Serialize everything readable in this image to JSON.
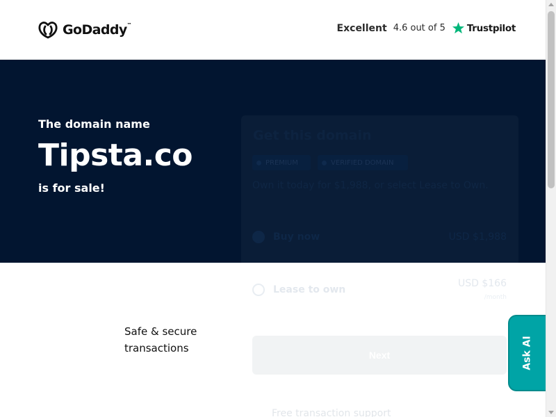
{
  "header": {
    "logo_text": "GoDaddy",
    "logo_tm": "™",
    "rating_label": "Excellent",
    "rating_score": "4.6 out of 5",
    "trustpilot": "Trustpilot"
  },
  "hero": {
    "kicker": "The domain name",
    "domain": "Tipsta.co",
    "for_sale": "is for sale!"
  },
  "card": {
    "title": "Get this domain",
    "chips": [
      "PREMIUM",
      "VERIFIED DOMAIN"
    ],
    "description": "Own it today for $1,988, or select Lease to Own.",
    "options": [
      {
        "label": "Buy now",
        "price": "USD $1,988",
        "sub": "",
        "selected": true
      },
      {
        "label": "Lease to own",
        "price": "USD $166",
        "sub": "/month",
        "selected": false
      }
    ],
    "next_label": "Next",
    "support_text": "Free transaction support"
  },
  "safe": {
    "text": "Safe & secure transactions"
  },
  "askai": {
    "label": "Ask AI"
  },
  "colors": {
    "hero_bg": "#021530",
    "trustpilot_green": "#00b67a",
    "askai_bg": "#00a4a6"
  }
}
